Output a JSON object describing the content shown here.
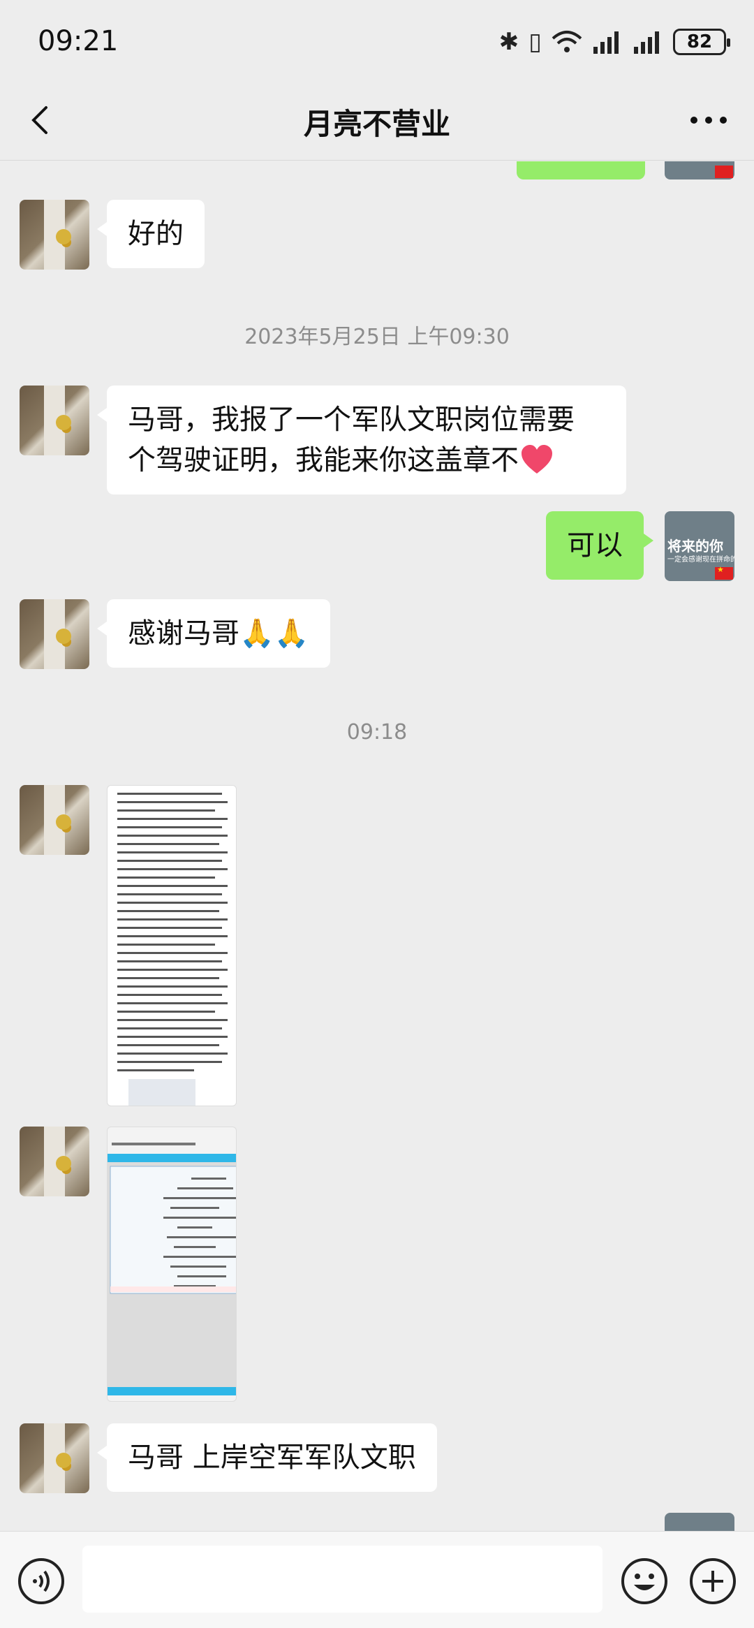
{
  "status_bar": {
    "time": "09:21",
    "battery": "82"
  },
  "header": {
    "title": "月亮不营业"
  },
  "messages": {
    "m1": "好的",
    "ts1": "2023年5月25日 上午09:30",
    "m2_line1": "马哥，我报了一个军队文职岗位需要",
    "m2_line2": "个驾驶证明，我能来你这盖章不",
    "m3": "可以",
    "m4": "感谢马哥",
    "ts2": "09:18",
    "m5": "马哥 上岸空军军队文职"
  },
  "my_avatar": {
    "line1": "将来的你",
    "line2": "一定会感谢现在拼命的自己"
  },
  "icons": [
    "chevron-left-icon",
    "more-icon",
    "voice-icon",
    "emoji-icon",
    "plus-icon",
    "heart-icon",
    "pray-icon"
  ],
  "colors": {
    "my_bubble": "#95ec69",
    "their_bubble": "#ffffff",
    "background": "#ededed"
  }
}
